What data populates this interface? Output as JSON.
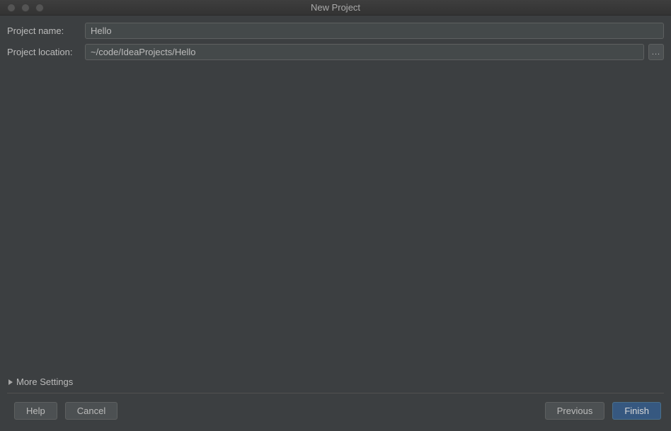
{
  "window": {
    "title": "New Project"
  },
  "form": {
    "name_label": "Project name:",
    "name_value": "Hello",
    "location_label": "Project location:",
    "location_value": "~/code/IdeaProjects/Hello",
    "browse_label": "..."
  },
  "more_settings": {
    "label": "More Settings"
  },
  "buttons": {
    "help": "Help",
    "cancel": "Cancel",
    "previous": "Previous",
    "finish": "Finish"
  }
}
